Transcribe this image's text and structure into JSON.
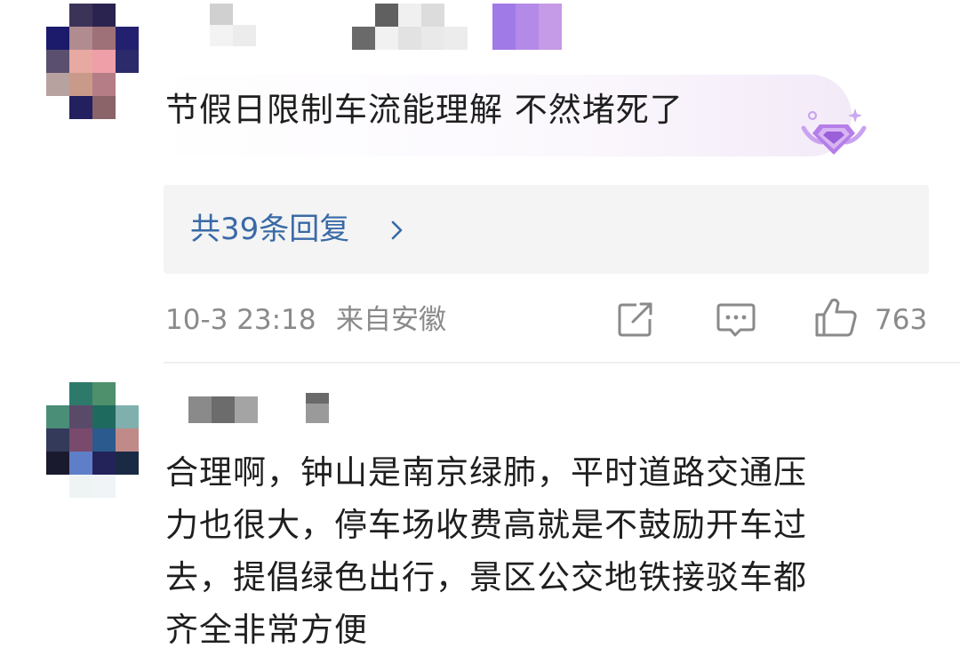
{
  "comments": [
    {
      "text": "节假日限制车流能理解 不然堵死了",
      "replies_label": "共39条回复",
      "timestamp": "10-3 23:18",
      "location": "来自安徽",
      "like_count": "763",
      "badge_icon": "diamond-badge-icon"
    },
    {
      "text_lines": [
        "合理啊，钟山是南京绿肺，平时道路交通压",
        "力也很大，停车场收费高就是不鼓励开车过",
        "去，提倡绿色出行，景区公交地铁接驳车都",
        "齐全非常方便"
      ]
    }
  ],
  "icons": {
    "share": "share-icon",
    "comment": "comment-icon",
    "like": "thumbs-up-icon",
    "chevron": "chevron-right-icon"
  },
  "colors": {
    "link": "#3a6aa6",
    "meta": "#8a8a8a",
    "reply_box": "#f4f4f4"
  }
}
